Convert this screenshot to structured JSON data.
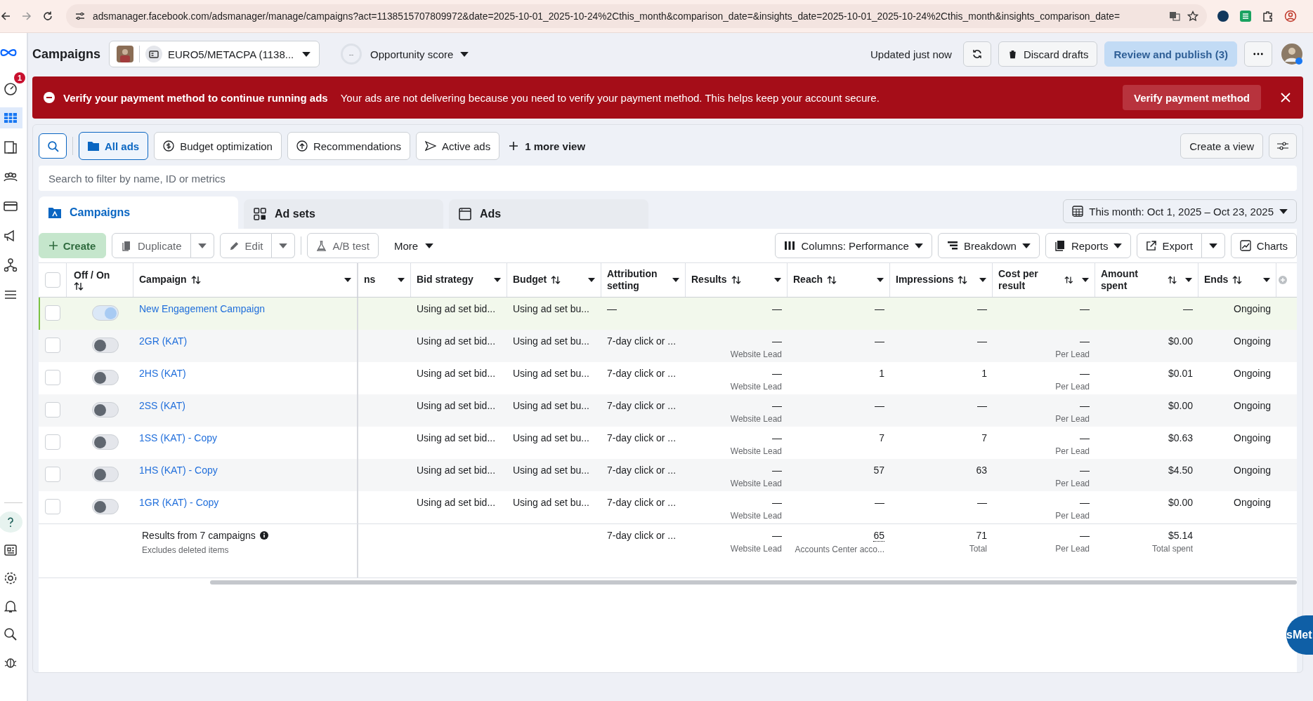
{
  "browser": {
    "url": "adsmanager.facebook.com/adsmanager/manage/campaigns?act=1138515707809972&date=2025-10-01_2025-10-24%2Cthis_month&comparison_date=&insights_date=2025-10-01_2025-10-24%2Cthis_month&insights_comparison_date="
  },
  "sidebar": {
    "badge": "1",
    "items": [
      {
        "kind": "gauge",
        "selected": false
      },
      {
        "kind": "table",
        "selected": true
      },
      {
        "kind": "pages",
        "selected": false
      },
      {
        "kind": "people",
        "selected": false
      },
      {
        "kind": "card",
        "selected": false
      },
      {
        "kind": "megaphone",
        "selected": false
      },
      {
        "kind": "network",
        "selected": false
      },
      {
        "kind": "menu",
        "selected": false
      }
    ]
  },
  "header": {
    "title": "Campaigns",
    "account": "EURO5/METACPA (1138...",
    "score": "--",
    "opportunity": "Opportunity score",
    "updated": "Updated just now",
    "discard": "Discard drafts",
    "publish": "Review and publish (3)",
    "publish_disabled": true
  },
  "banner": {
    "title": "Verify your payment method to continue running ads",
    "message": "Your ads are not delivering because you need to verify your payment method. This helps keep your account secure.",
    "button": "Verify payment method"
  },
  "views": [
    {
      "label": "All ads",
      "kind": "folder",
      "selected": true
    },
    {
      "label": "Budget optimization",
      "kind": "budget",
      "selected": false
    },
    {
      "label": "Recommendations",
      "kind": "recommendations",
      "selected": false
    },
    {
      "label": "Active ads",
      "kind": "active",
      "selected": false
    }
  ],
  "more_views": "1 more view",
  "create_view": "Create a view",
  "search": {
    "placeholder": "Search to filter by name, ID or metrics"
  },
  "levels": [
    {
      "label": "Campaigns",
      "kind": "campaign",
      "selected": true
    },
    {
      "label": "Ad sets",
      "kind": "adset",
      "selected": false
    },
    {
      "label": "Ads",
      "kind": "ad",
      "selected": false
    }
  ],
  "date_range": "This month: Oct 1, 2025 – Oct 23, 2025",
  "toolbar": {
    "create": "Create",
    "duplicate": "Duplicate",
    "edit": "Edit",
    "ab_test": "A/B test",
    "more": "More",
    "columns": "Columns: Performance",
    "breakdown": "Breakdown",
    "reports": "Reports",
    "export": "Export",
    "charts": "Charts"
  },
  "table": {
    "columns": [
      {
        "kind": "checkbox",
        "checked": false
      },
      {
        "kind": "toggle",
        "label": "Off / On",
        "sortable": true
      },
      {
        "kind": "data",
        "label": "Campaign",
        "sortable": true
      },
      {
        "kind": "data",
        "label": "ns",
        "sortable": false
      },
      {
        "kind": "data",
        "label": "Bid strategy",
        "sortable": false
      },
      {
        "kind": "data",
        "label": "Budget",
        "sortable": true
      },
      {
        "kind": "data",
        "label": "Attribution setting",
        "sortable": false
      },
      {
        "kind": "data",
        "label": "Results",
        "sortable": true
      },
      {
        "kind": "data",
        "label": "Reach",
        "sortable": true
      },
      {
        "kind": "data",
        "label": "Impressions",
        "sortable": true
      },
      {
        "kind": "data",
        "label": "Cost per result",
        "sortable": true
      },
      {
        "kind": "data",
        "label": "Amount spent",
        "sortable": true
      },
      {
        "kind": "data",
        "label": "Ends",
        "sortable": true
      }
    ],
    "rows": [
      {
        "checked": false,
        "on": true,
        "draft": true,
        "name": "New Engagement Campaign",
        "bid": "Using ad set bid...",
        "budget": "Using ad set bu...",
        "attribution": "—",
        "results": "—",
        "reach": "—",
        "impressions": "—",
        "cost": "—",
        "amount": "—",
        "ends": "Ongoing"
      },
      {
        "checked": false,
        "on": false,
        "draft": false,
        "name": "2GR (KAT)",
        "bid": "Using ad set bid...",
        "budget": "Using ad set bu...",
        "attribution": "7-day click or ...",
        "results": "—",
        "results_sub": "Website Lead",
        "reach": "—",
        "impressions": "—",
        "cost": "—",
        "cost_sub": "Per Lead",
        "amount": "$0.00",
        "ends": "Ongoing"
      },
      {
        "checked": false,
        "on": false,
        "draft": false,
        "name": "2HS (KAT)",
        "bid": "Using ad set bid...",
        "budget": "Using ad set bu...",
        "attribution": "7-day click or ...",
        "results": "—",
        "results_sub": "Website Lead",
        "reach": "1",
        "impressions": "1",
        "cost": "—",
        "cost_sub": "Per Lead",
        "amount": "$0.01",
        "ends": "Ongoing"
      },
      {
        "checked": false,
        "on": false,
        "draft": false,
        "name": "2SS (KAT)",
        "bid": "Using ad set bid...",
        "budget": "Using ad set bu...",
        "attribution": "7-day click or ...",
        "results": "—",
        "results_sub": "Website Lead",
        "reach": "—",
        "impressions": "—",
        "cost": "—",
        "cost_sub": "Per Lead",
        "amount": "$0.00",
        "ends": "Ongoing"
      },
      {
        "checked": false,
        "on": false,
        "draft": false,
        "name": "1SS (KAT) - Copy",
        "bid": "Using ad set bid...",
        "budget": "Using ad set bu...",
        "attribution": "7-day click or ...",
        "results": "—",
        "results_sub": "Website Lead",
        "reach": "7",
        "impressions": "7",
        "cost": "—",
        "cost_sub": "Per Lead",
        "amount": "$0.63",
        "ends": "Ongoing"
      },
      {
        "checked": false,
        "on": false,
        "draft": false,
        "name": "1HS (KAT) - Copy",
        "bid": "Using ad set bid...",
        "budget": "Using ad set bu...",
        "attribution": "7-day click or ...",
        "results": "—",
        "results_sub": "Website Lead",
        "reach": "57",
        "impressions": "63",
        "cost": "—",
        "cost_sub": "Per Lead",
        "amount": "$4.50",
        "ends": "Ongoing"
      },
      {
        "checked": false,
        "on": false,
        "draft": false,
        "name": "1GR (KAT) - Copy",
        "bid": "Using ad set bid...",
        "budget": "Using ad set bu...",
        "attribution": "7-day click or ...",
        "results": "—",
        "results_sub": "Website Lead",
        "reach": "—",
        "impressions": "—",
        "cost": "—",
        "cost_sub": "Per Lead",
        "amount": "$0.00",
        "ends": "Ongoing"
      }
    ],
    "footer": {
      "label": "Results from 7 campaigns",
      "note": "Excludes deleted items",
      "attribution": "7-day click or ...",
      "results": "—",
      "results_sub": "Website Lead",
      "reach": "65",
      "reach_sub": "Accounts Center acco...",
      "impressions": "71",
      "impressions_sub": "Total",
      "cost": "—",
      "cost_sub": "Per Lead",
      "amount": "$5.14",
      "amount_sub": "Total spent"
    }
  },
  "extension_bubble": "sMet"
}
